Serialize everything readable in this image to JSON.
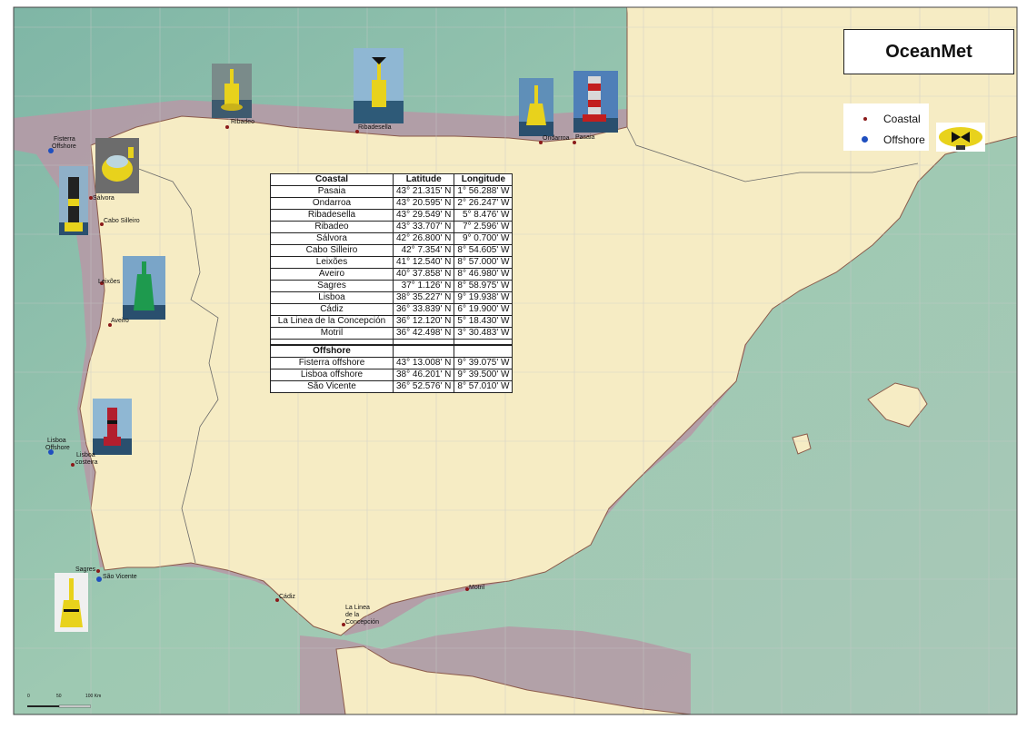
{
  "title": "OceanMet",
  "legend": {
    "coastal_label": "Coastal",
    "offshore_label": "Offshore",
    "coastal_color": "#8b1a1a",
    "offshore_color": "#1f4fbf"
  },
  "table": {
    "headers": [
      "Coastal",
      "Latitude",
      "Longitude"
    ],
    "coastal_rows": [
      [
        "Pasaia",
        "43° 21.315' N",
        "1° 56.288' W"
      ],
      [
        "Ondarroa",
        "43° 20.595' N",
        "2° 26.247' W"
      ],
      [
        "Ribadesella",
        "43° 29.549' N",
        "5°  8.476' W"
      ],
      [
        "Ribadeo",
        "43° 33.707' N",
        "7°  2.596' W"
      ],
      [
        "Sálvora",
        "42° 26.800' N",
        "9°  0.700' W"
      ],
      [
        "Cabo Silleiro",
        "42°  7.354' N",
        "8° 54.605' W"
      ],
      [
        "Leixões",
        "41° 12.540' N",
        "8° 57.000' W"
      ],
      [
        "Aveiro",
        "40° 37.858' N",
        "8° 46.980' W"
      ],
      [
        "Sagres",
        "37°   1.126' N",
        "8° 58.975' W"
      ],
      [
        "Lisboa",
        "38° 35.227' N",
        "9° 19.938' W"
      ],
      [
        "Cádiz",
        "36° 33.839' N",
        "6° 19.900' W"
      ],
      [
        "La Linea de la Concepción",
        "36° 12.120' N",
        "5° 18.430' W"
      ],
      [
        "Motril",
        "36° 42.498' N",
        "3° 30.483' W"
      ]
    ],
    "offshore_header": "Offshore",
    "offshore_rows": [
      [
        "Fisterra offshore",
        "43° 13.008' N",
        "9° 39.075' W"
      ],
      [
        "Lisboa offshore",
        "38° 46.201' N",
        "9° 39.500' W"
      ],
      [
        "São Vicente",
        "36° 52.576' N",
        "8° 57.010' W"
      ]
    ]
  },
  "map_labels": {
    "ribadeo": "Ribadeo",
    "ribadesella": "Ribadesella",
    "ondarroa": "Ondarroa",
    "pasaia": "Pasaia",
    "fisterra_1": "Fisterra",
    "fisterra_2": "Offshore",
    "salvora": "Sálvora",
    "cabo_silleiro": "Cabo Silleiro",
    "leixoes": "Leixões",
    "aveiro": "Aveiro",
    "lisboa_offshore_1": "Lisboa",
    "lisboa_offshore_2": "Offshore",
    "lisboa_costeira_1": "Lisboa",
    "lisboa_costeira_2": "costeira",
    "sagres": "Sagres",
    "sao_vicente": "São Vicente",
    "cadiz": "Cádiz",
    "la_linea_1": "La Linea",
    "la_linea_2": "de la",
    "la_linea_3": "Concepción",
    "motril": "Motril"
  },
  "scale_bar": {
    "ticks": [
      "0",
      "50",
      "100 Km"
    ]
  },
  "colors": {
    "land": "#f6ecc4",
    "sea_shelf": "#b48c9a",
    "sea_deep": "#9cc7b3",
    "atlantic": "#8bbfae"
  }
}
